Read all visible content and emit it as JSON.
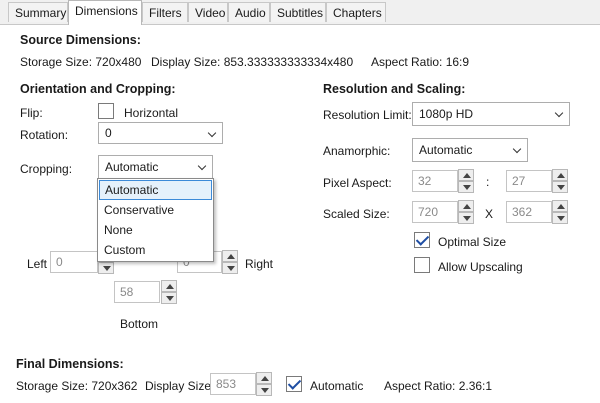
{
  "tabs": [
    {
      "label": "Summary",
      "active": false
    },
    {
      "label": "Dimensions",
      "active": true
    },
    {
      "label": "Filters",
      "active": false
    },
    {
      "label": "Video",
      "active": false
    },
    {
      "label": "Audio",
      "active": false
    },
    {
      "label": "Subtitles",
      "active": false
    },
    {
      "label": "Chapters",
      "active": false
    }
  ],
  "source": {
    "title": "Source Dimensions:",
    "storage": "Storage Size: 720x480",
    "display": "Display Size: 853.333333333334x480",
    "aspect": "Aspect Ratio: 16:9"
  },
  "orientation": {
    "title": "Orientation and Cropping:",
    "flip_label": "Flip:",
    "horizontal_label": "Horizontal",
    "rotation_label": "Rotation:",
    "rotation_value": "0",
    "cropping_label": "Cropping:",
    "cropping_value": "Automatic",
    "cropping_options": [
      "Automatic",
      "Conservative",
      "None",
      "Custom"
    ],
    "left_label": "Left",
    "left_value": "0",
    "right_label": "Right",
    "right_value": "0",
    "bottom_label": "Bottom",
    "bottom_value": "58"
  },
  "resolution": {
    "title": "Resolution and Scaling:",
    "limit_label": "Resolution Limit:",
    "limit_value": "1080p HD",
    "anamorphic_label": "Anamorphic:",
    "anamorphic_value": "Automatic",
    "pixel_aspect_label": "Pixel Aspect:",
    "pixel_aspect_x": "32",
    "colon": ":",
    "pixel_aspect_y": "27",
    "scaled_label": "Scaled Size:",
    "scaled_w": "720",
    "times": "X",
    "scaled_h": "362",
    "optimal_label": "Optimal Size",
    "optimal_checked": true,
    "upscaling_label": "Allow Upscaling",
    "upscaling_checked": false
  },
  "final": {
    "title": "Final Dimensions:",
    "storage": "Storage Size: 720x362",
    "display_label": "Display Size:",
    "display_value": "853",
    "automatic_label": "Automatic",
    "automatic_checked": true,
    "aspect": "Aspect Ratio: 2.36:1"
  }
}
